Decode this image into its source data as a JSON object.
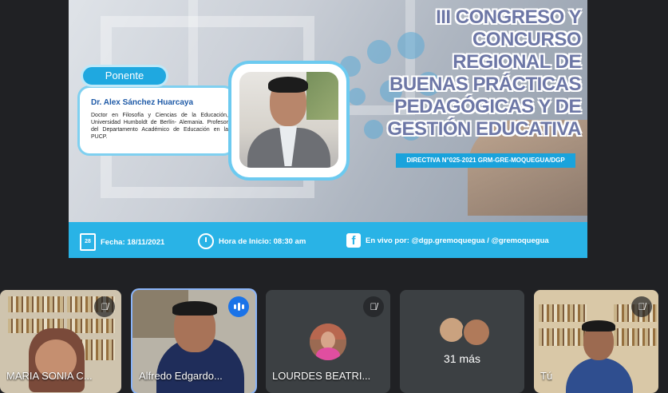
{
  "slide": {
    "title_lines": [
      "III CONGRESO Y",
      "CONCURSO",
      "REGIONAL DE",
      "BUENAS PRÁCTICAS",
      "PEDAGÓGICAS Y DE",
      "GESTIÓN EDUCATIVA"
    ],
    "directiva": "DIRECTIVA N°025-2021 GRM-GRE-MOQUEGUA/DGP",
    "ponente_label": "Ponente",
    "speaker_name": "Dr. Alex Sánchez Huarcaya",
    "speaker_desc": "Doctor en Filosofía y Ciencias de la Educación, Universidad Humboldt de Berlín- Alemania. Profesor del Departamento Académico de Educación en la PUCP.",
    "calendar_day": "28",
    "fecha": "Fecha: 18/11/2021",
    "hora": "Hora de Inicio: 08:30 am",
    "en_vivo": "En vivo por: @dgp.gremoquegua  /  @gremoquegua"
  },
  "participants": [
    {
      "name": "MARIA SONIA C...",
      "muted": true
    },
    {
      "name": "Alfredo Edgardo...",
      "speaking": true
    },
    {
      "name": "LOURDES BEATRI...",
      "muted": true
    },
    {
      "more_label": "31 más",
      "muted": false
    },
    {
      "name": "Tú",
      "muted": true
    }
  ],
  "icons": {
    "mic_off": "mic-off-icon",
    "speaking": "audio-level-icon",
    "calendar": "calendar-icon",
    "clock": "clock-icon",
    "facebook": "facebook-icon"
  },
  "colors": {
    "title": "#6d77a6",
    "accent": "#29b3e6",
    "tile_bg": "#3c4043",
    "meet_bg": "#202124",
    "speaking_ring": "#8ab4f8"
  }
}
